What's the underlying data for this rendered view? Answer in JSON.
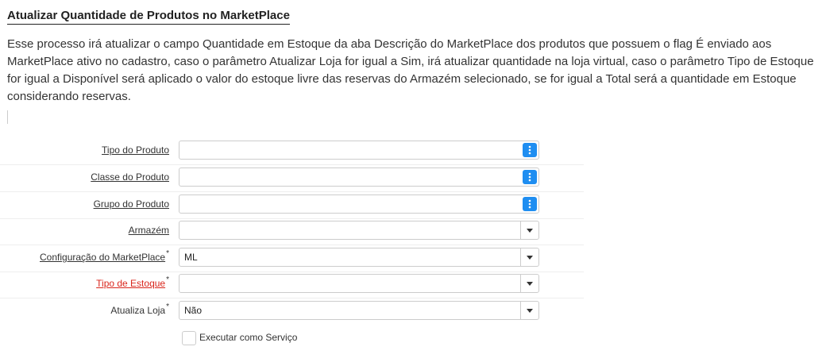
{
  "page": {
    "title": "Atualizar Quantidade de Produtos no MarketPlace",
    "description": "Esse processo irá atualizar o campo Quantidade em Estoque da aba Descrição do MarketPlace dos produtos que possuem o flag É enviado aos MarketPlace ativo no cadastro, caso o parâmetro Atualizar Loja for igual a Sim, irá atualizar quantidade na loja virtual, caso o parâmetro Tipo de Estoque for igual a Disponível será aplicado o valor do estoque livre das reservas do Armazém selecionado, se for igual a Total será a quantidade em Estoque considerando reservas."
  },
  "form": {
    "tipo_produto": {
      "label": "Tipo do Produto",
      "value": ""
    },
    "classe_produto": {
      "label": "Classe do Produto",
      "value": ""
    },
    "grupo_produto": {
      "label": "Grupo do Produto",
      "value": ""
    },
    "armazem": {
      "label": "Armazém",
      "value": ""
    },
    "config_marketplace": {
      "label": "Configuração do MarketPlace",
      "required_mark": "*",
      "value": "ML"
    },
    "tipo_estoque": {
      "label": "Tipo de Estoque",
      "required_mark": "*",
      "value": ""
    },
    "atualiza_loja": {
      "label": "Atualiza Loja",
      "required_mark": "*",
      "value": "Não"
    },
    "executar_servico": {
      "label": "Executar como Serviço",
      "checked": false
    }
  },
  "icons": {
    "lookup": "more-vertical-icon",
    "dropdown": "caret-down-icon"
  },
  "colors": {
    "lookup_button": "#1f8ef1",
    "required_label": "#d9261c"
  }
}
